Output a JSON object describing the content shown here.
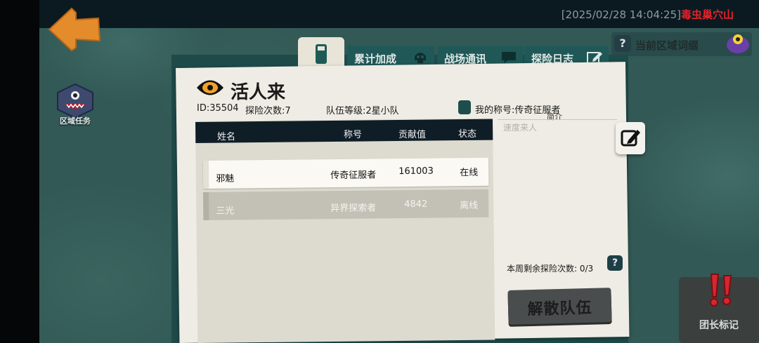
{
  "status_bar": {
    "timestamp": "[2025/02/28 14:04:25]",
    "location": "毒虫巢穴山"
  },
  "nav": {
    "back_icon": "back-arrow-icon"
  },
  "side_buttons": {
    "region_task": "区域任务"
  },
  "tabs": [
    {
      "label": "累计加成",
      "icon": "skull-icon"
    },
    {
      "label": "战场通讯",
      "icon": "chat-bubble-icon"
    },
    {
      "label": "探险日志",
      "icon": "edit-icon"
    }
  ],
  "current_zone": {
    "label": "当前区域词缀",
    "help": "?"
  },
  "team": {
    "name": "活人来",
    "id_label": "ID:35504",
    "explore_count_label": "探险次数:7",
    "level_label": "队伍等级:2星小队",
    "my_title_label": "我的称号:传奇征服者",
    "intro_label": "简介",
    "intro_text": "速度来人"
  },
  "table": {
    "headers": [
      "姓名",
      "称号",
      "贡献值",
      "状态"
    ],
    "rows": [
      {
        "name": "邪魅",
        "title": "传奇征服者",
        "contribution": "161003",
        "status": "在线"
      },
      {
        "name": "三光",
        "title": "异界探索者",
        "contribution": "4842",
        "status": "离线"
      }
    ]
  },
  "weekly": {
    "label": "本周剩余探险次数:",
    "value": "0/3",
    "help": "?"
  },
  "buttons": {
    "disband": "解散队伍",
    "leader_mark": "团长标记"
  },
  "colors": {
    "alert_red": "#e8202a",
    "tab_teal": "#1f5857",
    "back_orange": "#e48b2c"
  }
}
